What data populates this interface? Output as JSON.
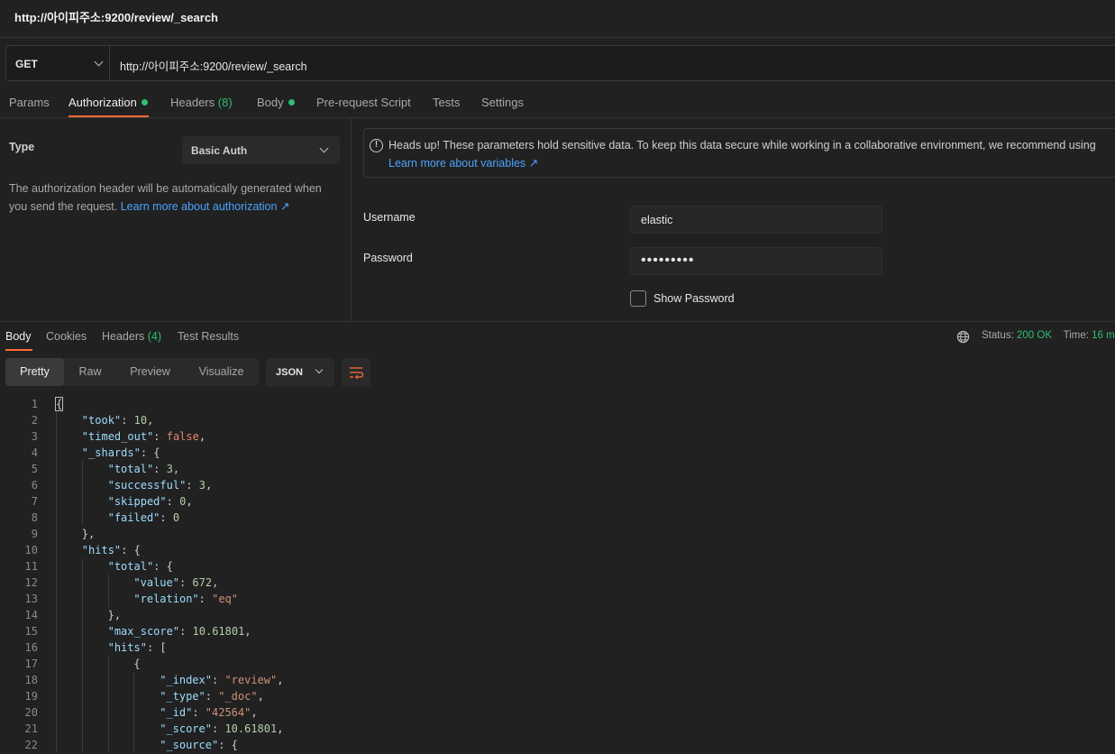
{
  "window": {
    "title": "http://아이피주소:9200/review/_search"
  },
  "request": {
    "method": "GET",
    "url": "http://아이피주소:9200/review/_search",
    "tabs": [
      {
        "label": "Params"
      },
      {
        "label": "Authorization",
        "dot": true,
        "active": true
      },
      {
        "label": "Headers",
        "count": "(8)"
      },
      {
        "label": "Body",
        "dot": true
      },
      {
        "label": "Pre-request Script"
      },
      {
        "label": "Tests"
      },
      {
        "label": "Settings"
      }
    ]
  },
  "auth": {
    "type_label": "Type",
    "type_value": "Basic Auth",
    "description": "The authorization header will be automatically generated when you send the request.",
    "learn_more": "Learn more about authorization ↗",
    "notice_text": "Heads up! These parameters hold sensitive data. To keep this data secure while working in a collaborative environment, we recommend using",
    "notice_link": "Learn more about variables ↗",
    "username_label": "Username",
    "username_value": "elastic",
    "password_label": "Password",
    "password_value": "•••••••••",
    "show_password_label": "Show Password"
  },
  "response": {
    "tabs": [
      {
        "label": "Body",
        "active": true
      },
      {
        "label": "Cookies"
      },
      {
        "label": "Headers",
        "count": "(4)"
      },
      {
        "label": "Test Results"
      }
    ],
    "status_label": "Status:",
    "status_value": "200 OK",
    "time_label": "Time:",
    "time_value": "16 m",
    "views": [
      "Pretty",
      "Raw",
      "Preview",
      "Visualize"
    ],
    "active_view": "Pretty",
    "format": "JSON",
    "icons": {
      "globe": "globe-icon",
      "wrap": "wrap-lines-icon",
      "info": "info-icon"
    },
    "colors": {
      "accent": "#ff6c37",
      "success": "#2fbf71",
      "link": "#4aa3ff"
    }
  },
  "code_lines": [
    {
      "n": "1",
      "indent": 0,
      "t": [
        [
          "p",
          "{"
        ]
      ]
    },
    {
      "n": "2",
      "indent": 1,
      "t": [
        [
          "k",
          "\"took\""
        ],
        [
          "p",
          ": "
        ],
        [
          "n",
          "10"
        ],
        [
          "p",
          ","
        ]
      ]
    },
    {
      "n": "3",
      "indent": 1,
      "t": [
        [
          "k",
          "\"timed_out\""
        ],
        [
          "p",
          ": "
        ],
        [
          "b",
          "false"
        ],
        [
          "p",
          ","
        ]
      ]
    },
    {
      "n": "4",
      "indent": 1,
      "t": [
        [
          "k",
          "\"_shards\""
        ],
        [
          "p",
          ": {"
        ]
      ]
    },
    {
      "n": "5",
      "indent": 2,
      "t": [
        [
          "k",
          "\"total\""
        ],
        [
          "p",
          ": "
        ],
        [
          "n",
          "3"
        ],
        [
          "p",
          ","
        ]
      ]
    },
    {
      "n": "6",
      "indent": 2,
      "t": [
        [
          "k",
          "\"successful\""
        ],
        [
          "p",
          ": "
        ],
        [
          "n",
          "3"
        ],
        [
          "p",
          ","
        ]
      ]
    },
    {
      "n": "7",
      "indent": 2,
      "t": [
        [
          "k",
          "\"skipped\""
        ],
        [
          "p",
          ": "
        ],
        [
          "n",
          "0"
        ],
        [
          "p",
          ","
        ]
      ]
    },
    {
      "n": "8",
      "indent": 2,
      "t": [
        [
          "k",
          "\"failed\""
        ],
        [
          "p",
          ": "
        ],
        [
          "n",
          "0"
        ]
      ]
    },
    {
      "n": "9",
      "indent": 1,
      "t": [
        [
          "p",
          "},"
        ]
      ]
    },
    {
      "n": "10",
      "indent": 1,
      "t": [
        [
          "k",
          "\"hits\""
        ],
        [
          "p",
          ": {"
        ]
      ]
    },
    {
      "n": "11",
      "indent": 2,
      "t": [
        [
          "k",
          "\"total\""
        ],
        [
          "p",
          ": {"
        ]
      ]
    },
    {
      "n": "12",
      "indent": 3,
      "t": [
        [
          "k",
          "\"value\""
        ],
        [
          "p",
          ": "
        ],
        [
          "n",
          "672"
        ],
        [
          "p",
          ","
        ]
      ]
    },
    {
      "n": "13",
      "indent": 3,
      "t": [
        [
          "k",
          "\"relation\""
        ],
        [
          "p",
          ": "
        ],
        [
          "s",
          "\"eq\""
        ]
      ]
    },
    {
      "n": "14",
      "indent": 2,
      "t": [
        [
          "p",
          "},"
        ]
      ]
    },
    {
      "n": "15",
      "indent": 2,
      "t": [
        [
          "k",
          "\"max_score\""
        ],
        [
          "p",
          ": "
        ],
        [
          "n",
          "10.61801"
        ],
        [
          "p",
          ","
        ]
      ]
    },
    {
      "n": "16",
      "indent": 2,
      "t": [
        [
          "k",
          "\"hits\""
        ],
        [
          "p",
          ": ["
        ]
      ]
    },
    {
      "n": "17",
      "indent": 3,
      "t": [
        [
          "p",
          "{"
        ]
      ]
    },
    {
      "n": "18",
      "indent": 4,
      "t": [
        [
          "k",
          "\"_index\""
        ],
        [
          "p",
          ": "
        ],
        [
          "s",
          "\"review\""
        ],
        [
          "p",
          ","
        ]
      ]
    },
    {
      "n": "19",
      "indent": 4,
      "t": [
        [
          "k",
          "\"_type\""
        ],
        [
          "p",
          ": "
        ],
        [
          "s",
          "\"_doc\""
        ],
        [
          "p",
          ","
        ]
      ]
    },
    {
      "n": "20",
      "indent": 4,
      "t": [
        [
          "k",
          "\"_id\""
        ],
        [
          "p",
          ": "
        ],
        [
          "s",
          "\"42564\""
        ],
        [
          "p",
          ","
        ]
      ]
    },
    {
      "n": "21",
      "indent": 4,
      "t": [
        [
          "k",
          "\"_score\""
        ],
        [
          "p",
          ": "
        ],
        [
          "n",
          "10.61801"
        ],
        [
          "p",
          ","
        ]
      ]
    },
    {
      "n": "22",
      "indent": 4,
      "t": [
        [
          "k",
          "\"_source\""
        ],
        [
          "p",
          ": {"
        ]
      ]
    }
  ]
}
